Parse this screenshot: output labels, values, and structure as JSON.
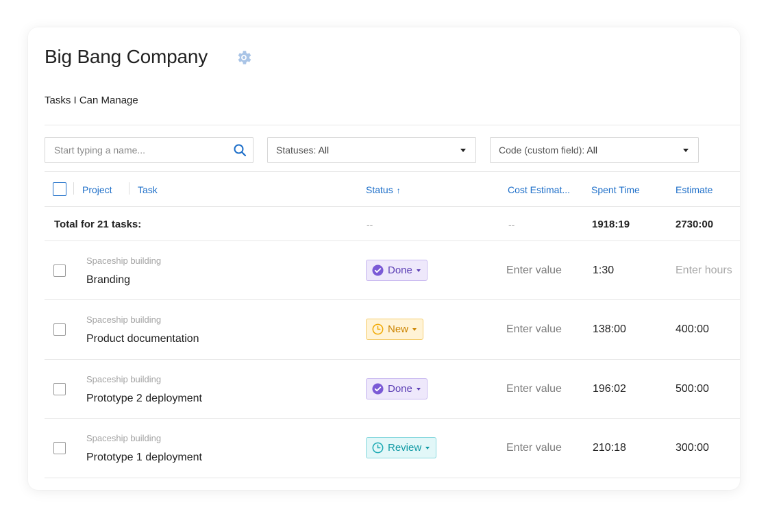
{
  "company": {
    "name": "Big Bang Company"
  },
  "view": {
    "title": "Tasks I Can Manage"
  },
  "filters": {
    "search_placeholder": "Start typing a name...",
    "statuses_label": "Statuses:",
    "statuses_value": "All",
    "code_label": "Code (custom field):",
    "code_value": "All"
  },
  "table": {
    "headers": {
      "project": "Project",
      "task": "Task",
      "status": "Status",
      "status_sort": "↑",
      "cost_estimate": "Cost Estimat...",
      "spent_time": "Spent Time",
      "estimate": "Estimate"
    },
    "total": {
      "label": "Total for 21 tasks:",
      "status": "--",
      "cost_estimate": "--",
      "spent_time": "1918:19",
      "estimate": "2730:00"
    },
    "rows": [
      {
        "project": "Spaceship building",
        "task": "Branding",
        "status": "Done",
        "cost_estimate": "Enter value",
        "spent_time": "1:30",
        "estimate": "Enter hours"
      },
      {
        "project": "Spaceship building",
        "task": "Product documentation",
        "status": "New",
        "cost_estimate": "Enter value",
        "spent_time": "138:00",
        "estimate": "400:00"
      },
      {
        "project": "Spaceship building",
        "task": "Prototype 2 deployment",
        "status": "Done",
        "cost_estimate": "Enter value",
        "spent_time": "196:02",
        "estimate": "500:00"
      },
      {
        "project": "Spaceship building",
        "task": "Prototype 1 deployment",
        "status": "Review",
        "cost_estimate": "Enter value",
        "spent_time": "210:18",
        "estimate": "300:00"
      }
    ]
  },
  "colors": {
    "link_blue": "#1e6fc9",
    "done": "#7b5ad6",
    "new": "#f0a800",
    "review": "#1aa9b3"
  }
}
